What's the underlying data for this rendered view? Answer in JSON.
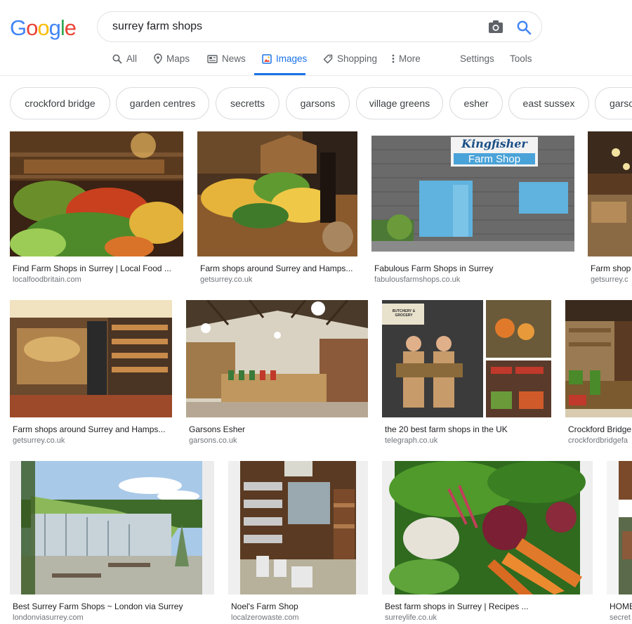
{
  "logo": {
    "letters": [
      "G",
      "o",
      "o",
      "g",
      "l",
      "e"
    ],
    "colors": [
      "#4285F4",
      "#EA4335",
      "#FBBC05",
      "#4285F4",
      "#34A853",
      "#EA4335"
    ]
  },
  "search": {
    "query": "surrey farm shops"
  },
  "tabs": {
    "all": "All",
    "maps": "Maps",
    "news": "News",
    "images": "Images",
    "shopping": "Shopping",
    "more": "More",
    "settings": "Settings",
    "tools": "Tools"
  },
  "chips": [
    "crockford bridge",
    "garden centres",
    "secretts",
    "garsons",
    "village greens",
    "esher",
    "east sussex",
    "garso"
  ],
  "results": [
    {
      "title": "Find Farm Shops in Surrey | Local Food ...",
      "source": "localfoodbritain.com"
    },
    {
      "title": "Farm shops around Surrey and Hamps...",
      "source": "getsurrey.co.uk"
    },
    {
      "title": "Fabulous Farm Shops in Surrey",
      "source": "fabulousfarmshops.co.uk",
      "sign_line1": "Kingfisher",
      "sign_line2": "Farm Shop"
    },
    {
      "title": "Farm shop",
      "source": "getsurrey.c"
    },
    {
      "title": "Farm shops around Surrey and Hamps...",
      "source": "getsurrey.co.uk"
    },
    {
      "title": "Garsons Esher",
      "source": "garsons.co.uk"
    },
    {
      "title": "the 20 best farm shops in the UK",
      "source": "telegraph.co.uk",
      "sign": "BUTCHERY & GROCERY"
    },
    {
      "title": "Crockford Bridge",
      "source": "crockfordbridgefa"
    },
    {
      "title": "Best Surrey Farm Shops ~ London via Surrey",
      "source": "londonviasurrey.com"
    },
    {
      "title": "Noel's Farm Shop",
      "source": "localzerowaste.com"
    },
    {
      "title": "Best farm shops in Surrey | Recipes ...",
      "source": "surreylife.co.uk"
    },
    {
      "title": "HOME",
      "source": "secret"
    }
  ],
  "colors": {
    "accent": "#1a73e8",
    "border": "#dfe1e5",
    "muted": "#70757a"
  }
}
